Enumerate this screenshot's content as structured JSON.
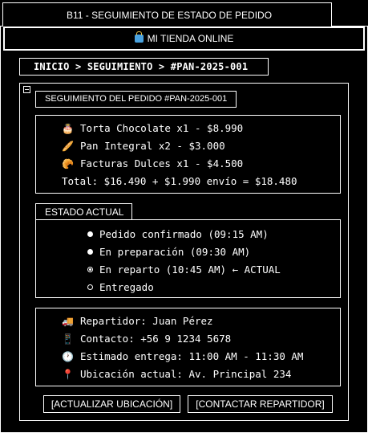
{
  "window": {
    "title": "B11 - SEGUIMIENTO DE ESTADO DE PEDIDO"
  },
  "store": {
    "name": "MI TIENDA ONLINE",
    "icon": "shopping-bag-icon"
  },
  "breadcrumb": "INICIO > SEGUIMIENTO > #PAN-2025-001",
  "order": {
    "section_title": "SEGUIMIENTO DEL PEDIDO #PAN-2025-001",
    "items": [
      {
        "icon": "cake-icon",
        "text": "Torta Chocolate x1 - $8.990"
      },
      {
        "icon": "bread-icon",
        "text": "Pan Integral x2 - $3.000"
      },
      {
        "icon": "croissant-icon",
        "text": "Facturas Dulces x1 - $4.500"
      }
    ],
    "total": "Total: $16.490 + $1.990 envío = $18.480"
  },
  "status": {
    "label": "ESTADO ACTUAL",
    "steps": [
      {
        "text": "Pedido confirmado (09:15 AM)",
        "state": "done"
      },
      {
        "text": "En preparación (09:30 AM)",
        "state": "done"
      },
      {
        "text": "En reparto (10:45 AM) ← ACTUAL",
        "state": "current"
      },
      {
        "text": "Entregado",
        "state": "pending"
      }
    ]
  },
  "delivery": {
    "rows": [
      {
        "icon": "truck-icon",
        "text": "Repartidor: Juan Pérez"
      },
      {
        "icon": "phone-icon",
        "text": "Contacto: +56 9 1234 5678"
      },
      {
        "icon": "clock-icon",
        "text": "Estimado entrega: 11:00 AM - 11:30 AM"
      },
      {
        "icon": "pin-icon",
        "text": "Ubicación actual: Av. Principal 234"
      }
    ]
  },
  "buttons": {
    "update_location": "[ACTUALIZAR UBICACIÓN]",
    "contact_driver": "[CONTACTAR REPARTIDOR]"
  }
}
